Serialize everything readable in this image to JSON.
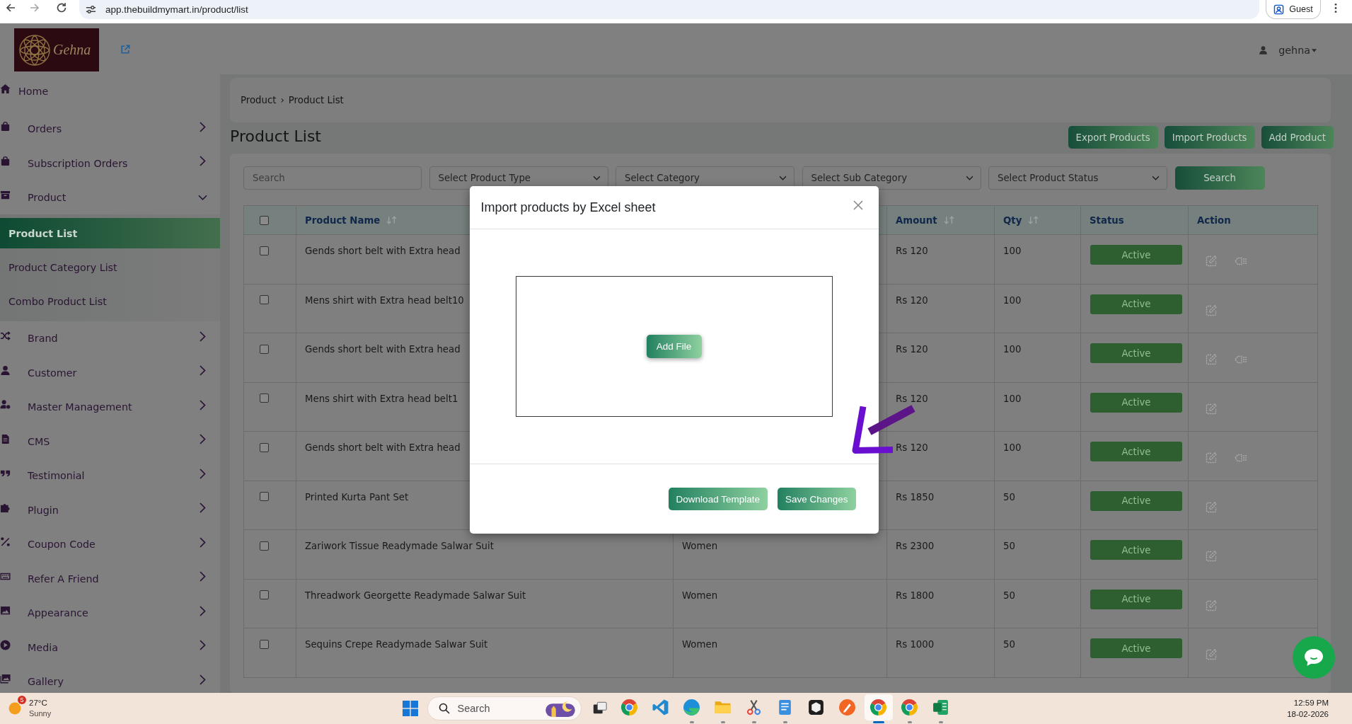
{
  "browser": {
    "url": "app.thebuildmymart.in/product/list",
    "profile": "Guest",
    "forward_disabled": true
  },
  "header": {
    "logo_text": "Gehna",
    "user": "gehna"
  },
  "sidebar": {
    "items": [
      {
        "label": "Home",
        "kind": "link"
      },
      {
        "label": "Orders",
        "kind": "group",
        "expanded": false
      },
      {
        "label": "Subscription Orders",
        "kind": "group",
        "expanded": false
      },
      {
        "label": "Product",
        "kind": "group",
        "expanded": true,
        "children": [
          {
            "label": "Product List",
            "selected": true
          },
          {
            "label": "Product Category List",
            "selected": false
          },
          {
            "label": "Combo Product List",
            "selected": false
          }
        ]
      },
      {
        "label": "Brand",
        "kind": "group",
        "expanded": false
      },
      {
        "label": "Customer",
        "kind": "group",
        "expanded": false
      },
      {
        "label": "Master Management",
        "kind": "group",
        "expanded": false
      },
      {
        "label": "CMS",
        "kind": "group",
        "expanded": false
      },
      {
        "label": "Testimonial",
        "kind": "group",
        "expanded": false
      },
      {
        "label": "Plugin",
        "kind": "group",
        "expanded": false
      },
      {
        "label": "Coupon Code",
        "kind": "group",
        "expanded": false
      },
      {
        "label": "Refer A Friend",
        "kind": "group",
        "expanded": false
      },
      {
        "label": "Appearance",
        "kind": "group",
        "expanded": false
      },
      {
        "label": "Media",
        "kind": "group",
        "expanded": false
      },
      {
        "label": "Gallery",
        "kind": "group",
        "expanded": false
      }
    ]
  },
  "breadcrumb": {
    "items": [
      "Product",
      "Product List"
    ],
    "separator": "›"
  },
  "page_title": "Product List",
  "actions": [
    "Export Products",
    "Import Products",
    "Add Product"
  ],
  "filters": {
    "search_placeholder": "Search",
    "selects": [
      "Select Product Type",
      "Select Category",
      "Select Sub Category",
      "Select Product Status"
    ],
    "button": "Search"
  },
  "table": {
    "all_checked": false,
    "columns": [
      {
        "label": "Product Name",
        "sortable": true
      },
      {
        "label": "Amount",
        "sortable": true
      },
      {
        "label": "Qty",
        "sortable": true
      },
      {
        "label": "Status",
        "sortable": false
      },
      {
        "label": "Action",
        "sortable": false
      }
    ],
    "rows": [
      {
        "checked": false,
        "product_name": "Gends short belt with Extra head",
        "amount": "Rs 120",
        "qty": "100",
        "status": "Active",
        "actions": [
          {
            "kind": "edit"
          },
          {
            "kind": "tag"
          }
        ]
      },
      {
        "checked": false,
        "product_name": "Mens shirt with Extra head belt10",
        "amount": "Rs 120",
        "qty": "100",
        "status": "Active",
        "actions": [
          {
            "kind": "edit"
          }
        ]
      },
      {
        "checked": false,
        "product_name": "Gends short belt with Extra head",
        "amount": "Rs 120",
        "qty": "100",
        "status": "Active",
        "actions": [
          {
            "kind": "edit"
          },
          {
            "kind": "tag"
          }
        ]
      },
      {
        "checked": false,
        "product_name": "Mens shirt with Extra head belt1",
        "amount": "Rs 120",
        "qty": "100",
        "status": "Active",
        "actions": [
          {
            "kind": "edit"
          }
        ]
      },
      {
        "checked": false,
        "product_name": "Gends short belt with Extra head",
        "amount": "Rs 120",
        "qty": "100",
        "status": "Active",
        "actions": [
          {
            "kind": "edit"
          },
          {
            "kind": "tag"
          }
        ]
      },
      {
        "checked": false,
        "product_name": "Printed Kurta Pant Set",
        "amount": "Rs 1850",
        "qty": "50",
        "status": "Active",
        "actions": [
          {
            "kind": "edit"
          }
        ]
      },
      {
        "checked": false,
        "product_name": "Zariwork Tissue Readymade Salwar Suit",
        "column_3": "Women",
        "amount": "Rs 2300",
        "qty": "50",
        "status": "Active",
        "actions": [
          {
            "kind": "edit"
          }
        ]
      },
      {
        "checked": false,
        "product_name": "Threadwork Georgette Readymade Salwar Suit",
        "column_3": "Women",
        "amount": "Rs 1800",
        "qty": "50",
        "status": "Active",
        "actions": [
          {
            "kind": "edit"
          }
        ]
      },
      {
        "checked": false,
        "product_name": "Sequins Crepe Readymade Salwar Suit",
        "column_3": "Women",
        "amount": "Rs 1000",
        "qty": "50",
        "status": "Active",
        "actions": [
          {
            "kind": "edit"
          }
        ]
      }
    ]
  },
  "modal": {
    "title": "Import products by Excel sheet",
    "add_file": "Add File",
    "buttons": [
      "Download Template",
      "Save Changes"
    ]
  },
  "taskbar": {
    "weather": {
      "badge": "5",
      "temperature": "27°C",
      "condition": "Sunny"
    },
    "search_placeholder": "Search",
    "apps": [
      {
        "running": false,
        "selected": false
      },
      {
        "running": false,
        "selected": false
      },
      {
        "running": true,
        "selected": false
      },
      {
        "running": true,
        "selected": false
      },
      {
        "running": true,
        "selected": false
      },
      {
        "running": true,
        "selected": false
      },
      {
        "running": false,
        "selected": false
      },
      {
        "running": false,
        "selected": false
      },
      {
        "running": true,
        "selected": true
      },
      {
        "running": true,
        "selected": false
      },
      {
        "running": true,
        "selected": false
      }
    ],
    "time": "12:59 PM",
    "date": "18-02-2026"
  }
}
